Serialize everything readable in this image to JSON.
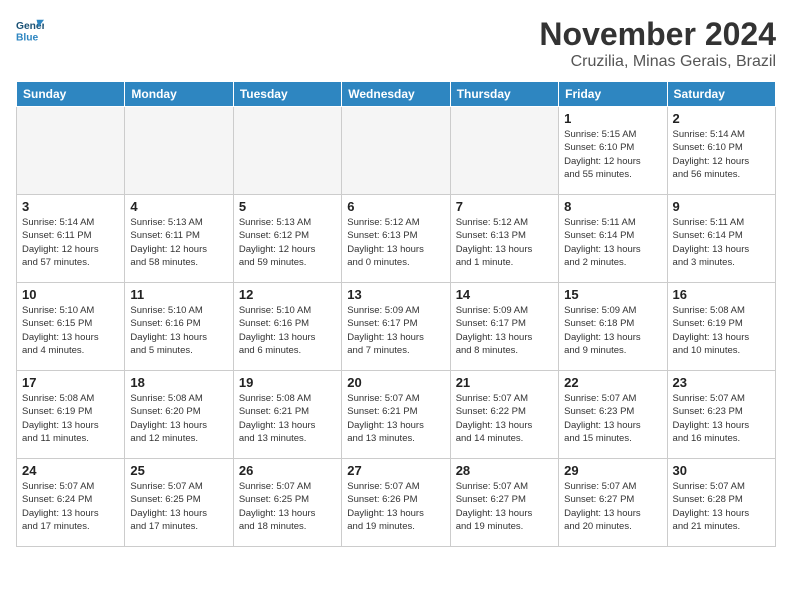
{
  "header": {
    "logo_line1": "General",
    "logo_line2": "Blue",
    "title": "November 2024",
    "subtitle": "Cruzilia, Minas Gerais, Brazil"
  },
  "weekdays": [
    "Sunday",
    "Monday",
    "Tuesday",
    "Wednesday",
    "Thursday",
    "Friday",
    "Saturday"
  ],
  "weeks": [
    [
      {
        "day": "",
        "info": ""
      },
      {
        "day": "",
        "info": ""
      },
      {
        "day": "",
        "info": ""
      },
      {
        "day": "",
        "info": ""
      },
      {
        "day": "",
        "info": ""
      },
      {
        "day": "1",
        "info": "Sunrise: 5:15 AM\nSunset: 6:10 PM\nDaylight: 12 hours\nand 55 minutes."
      },
      {
        "day": "2",
        "info": "Sunrise: 5:14 AM\nSunset: 6:10 PM\nDaylight: 12 hours\nand 56 minutes."
      }
    ],
    [
      {
        "day": "3",
        "info": "Sunrise: 5:14 AM\nSunset: 6:11 PM\nDaylight: 12 hours\nand 57 minutes."
      },
      {
        "day": "4",
        "info": "Sunrise: 5:13 AM\nSunset: 6:11 PM\nDaylight: 12 hours\nand 58 minutes."
      },
      {
        "day": "5",
        "info": "Sunrise: 5:13 AM\nSunset: 6:12 PM\nDaylight: 12 hours\nand 59 minutes."
      },
      {
        "day": "6",
        "info": "Sunrise: 5:12 AM\nSunset: 6:13 PM\nDaylight: 13 hours\nand 0 minutes."
      },
      {
        "day": "7",
        "info": "Sunrise: 5:12 AM\nSunset: 6:13 PM\nDaylight: 13 hours\nand 1 minute."
      },
      {
        "day": "8",
        "info": "Sunrise: 5:11 AM\nSunset: 6:14 PM\nDaylight: 13 hours\nand 2 minutes."
      },
      {
        "day": "9",
        "info": "Sunrise: 5:11 AM\nSunset: 6:14 PM\nDaylight: 13 hours\nand 3 minutes."
      }
    ],
    [
      {
        "day": "10",
        "info": "Sunrise: 5:10 AM\nSunset: 6:15 PM\nDaylight: 13 hours\nand 4 minutes."
      },
      {
        "day": "11",
        "info": "Sunrise: 5:10 AM\nSunset: 6:16 PM\nDaylight: 13 hours\nand 5 minutes."
      },
      {
        "day": "12",
        "info": "Sunrise: 5:10 AM\nSunset: 6:16 PM\nDaylight: 13 hours\nand 6 minutes."
      },
      {
        "day": "13",
        "info": "Sunrise: 5:09 AM\nSunset: 6:17 PM\nDaylight: 13 hours\nand 7 minutes."
      },
      {
        "day": "14",
        "info": "Sunrise: 5:09 AM\nSunset: 6:17 PM\nDaylight: 13 hours\nand 8 minutes."
      },
      {
        "day": "15",
        "info": "Sunrise: 5:09 AM\nSunset: 6:18 PM\nDaylight: 13 hours\nand 9 minutes."
      },
      {
        "day": "16",
        "info": "Sunrise: 5:08 AM\nSunset: 6:19 PM\nDaylight: 13 hours\nand 10 minutes."
      }
    ],
    [
      {
        "day": "17",
        "info": "Sunrise: 5:08 AM\nSunset: 6:19 PM\nDaylight: 13 hours\nand 11 minutes."
      },
      {
        "day": "18",
        "info": "Sunrise: 5:08 AM\nSunset: 6:20 PM\nDaylight: 13 hours\nand 12 minutes."
      },
      {
        "day": "19",
        "info": "Sunrise: 5:08 AM\nSunset: 6:21 PM\nDaylight: 13 hours\nand 13 minutes."
      },
      {
        "day": "20",
        "info": "Sunrise: 5:07 AM\nSunset: 6:21 PM\nDaylight: 13 hours\nand 13 minutes."
      },
      {
        "day": "21",
        "info": "Sunrise: 5:07 AM\nSunset: 6:22 PM\nDaylight: 13 hours\nand 14 minutes."
      },
      {
        "day": "22",
        "info": "Sunrise: 5:07 AM\nSunset: 6:23 PM\nDaylight: 13 hours\nand 15 minutes."
      },
      {
        "day": "23",
        "info": "Sunrise: 5:07 AM\nSunset: 6:23 PM\nDaylight: 13 hours\nand 16 minutes."
      }
    ],
    [
      {
        "day": "24",
        "info": "Sunrise: 5:07 AM\nSunset: 6:24 PM\nDaylight: 13 hours\nand 17 minutes."
      },
      {
        "day": "25",
        "info": "Sunrise: 5:07 AM\nSunset: 6:25 PM\nDaylight: 13 hours\nand 17 minutes."
      },
      {
        "day": "26",
        "info": "Sunrise: 5:07 AM\nSunset: 6:25 PM\nDaylight: 13 hours\nand 18 minutes."
      },
      {
        "day": "27",
        "info": "Sunrise: 5:07 AM\nSunset: 6:26 PM\nDaylight: 13 hours\nand 19 minutes."
      },
      {
        "day": "28",
        "info": "Sunrise: 5:07 AM\nSunset: 6:27 PM\nDaylight: 13 hours\nand 19 minutes."
      },
      {
        "day": "29",
        "info": "Sunrise: 5:07 AM\nSunset: 6:27 PM\nDaylight: 13 hours\nand 20 minutes."
      },
      {
        "day": "30",
        "info": "Sunrise: 5:07 AM\nSunset: 6:28 PM\nDaylight: 13 hours\nand 21 minutes."
      }
    ]
  ]
}
